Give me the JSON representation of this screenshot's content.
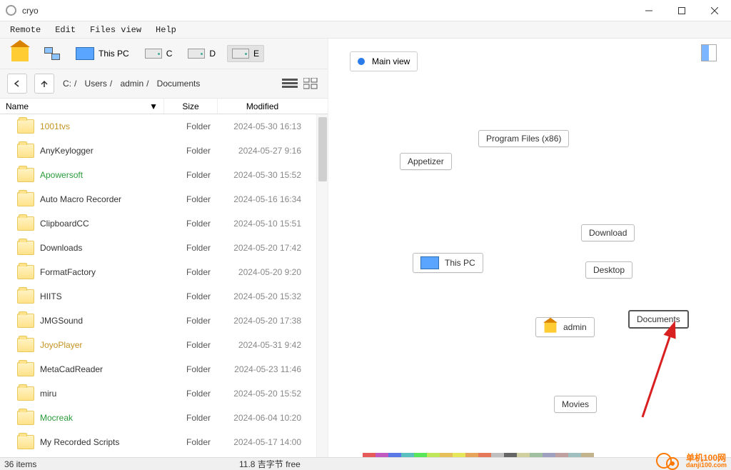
{
  "app": {
    "title": "cryo"
  },
  "menu": [
    "Remote",
    "Edit",
    "Files view",
    "Help"
  ],
  "toolbar": {
    "thispc": "This PC",
    "drives": [
      "C",
      "D",
      "E"
    ]
  },
  "nav": {
    "crumbs": [
      "C:",
      "/",
      "Users",
      "/",
      "admin",
      "/",
      "Documents"
    ]
  },
  "columns": {
    "name": "Name",
    "size": "Size",
    "modified": "Modified"
  },
  "files": [
    {
      "name": "1001tvs",
      "type": "Folder",
      "mod": "2024-05-30  16:13",
      "color": "#c49321"
    },
    {
      "name": "AnyKeylogger",
      "type": "Folder",
      "mod": "2024-05-27   9:16",
      "color": "#333"
    },
    {
      "name": "Apowersoft",
      "type": "Folder",
      "mod": "2024-05-30  15:52",
      "color": "#2a9a3a"
    },
    {
      "name": "Auto Macro Recorder",
      "type": "Folder",
      "mod": "2024-05-16  16:34",
      "color": "#333"
    },
    {
      "name": "ClipboardCC",
      "type": "Folder",
      "mod": "2024-05-10  15:51",
      "color": "#333"
    },
    {
      "name": "Downloads",
      "type": "Folder",
      "mod": "2024-05-20  17:42",
      "color": "#333"
    },
    {
      "name": "FormatFactory",
      "type": "Folder",
      "mod": "2024-05-20   9:20",
      "color": "#333"
    },
    {
      "name": "HIITS",
      "type": "Folder",
      "mod": "2024-05-20  15:32",
      "color": "#333"
    },
    {
      "name": "JMGSound",
      "type": "Folder",
      "mod": "2024-05-20  17:38",
      "color": "#333"
    },
    {
      "name": "JoyoPlayer",
      "type": "Folder",
      "mod": "2024-05-31   9:42",
      "color": "#c49321"
    },
    {
      "name": "MetaCadReader",
      "type": "Folder",
      "mod": "2024-05-23  11:46",
      "color": "#333"
    },
    {
      "name": "miru",
      "type": "Folder",
      "mod": "2024-05-20  15:52",
      "color": "#333"
    },
    {
      "name": "Mocreak",
      "type": "Folder",
      "mod": "2024-06-04  10:20",
      "color": "#2a9a3a"
    },
    {
      "name": "My Recorded Scripts",
      "type": "Folder",
      "mod": "2024-05-17  14:00",
      "color": "#333"
    }
  ],
  "graph": {
    "mainview": "Main view",
    "nodes": {
      "appetizer": "Appetizer",
      "programfiles": "Program Files (x86)",
      "thispc": "This PC",
      "download": "Download",
      "desktop": "Desktop",
      "admin": "admin",
      "documents": "Documents",
      "movies": "Movies"
    }
  },
  "status": {
    "items": "36 items",
    "free": "11.8 吉字节  free"
  },
  "watermark": {
    "text": "单机100网",
    "url": "danji100.com"
  },
  "colorstrip": [
    "#e65a5a",
    "#c05ac0",
    "#5a78e6",
    "#5ac0c0",
    "#5ae65a",
    "#c0e65a",
    "#e6c05a",
    "#e6e65a",
    "#e6a55a",
    "#e6785a",
    "#c0c0c0",
    "#666",
    "#d0d0a0",
    "#a0c0a0",
    "#a0a0c0",
    "#c0a0a0",
    "#a0c0c0",
    "#c3b48e"
  ]
}
